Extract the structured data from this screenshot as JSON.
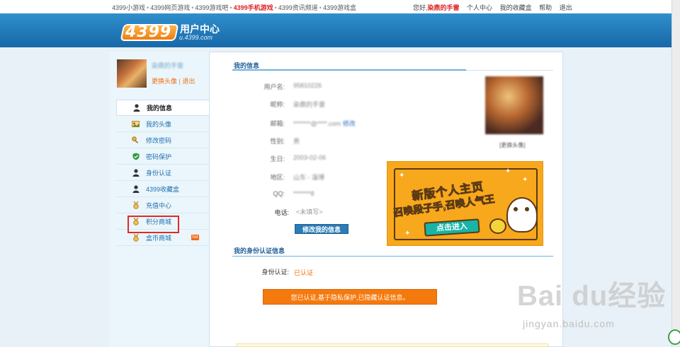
{
  "topbar": {
    "links": [
      "4399小游戏",
      "4399网页游戏",
      "4399游戏吧",
      "4399手机游戏",
      "4399资讯频道",
      "4399游戏盒"
    ],
    "hot_link_index": 3,
    "greeting": "您好,",
    "username": "染鼎的手雷",
    "user_links": [
      "个人中心",
      "我的收藏盒",
      "帮助",
      "退出"
    ]
  },
  "header": {
    "logo": "4399",
    "title": "用户中心",
    "subtitle": "u.4399.com"
  },
  "sidebar": {
    "username": "染鼎的手雷",
    "change_avatar": "更换头像",
    "separator": "|",
    "logout": "退出",
    "items": [
      {
        "label": "我的信息",
        "icon": "person-icon"
      },
      {
        "label": "我的头像",
        "icon": "photo-icon"
      },
      {
        "label": "修改密码",
        "icon": "key-icon"
      },
      {
        "label": "密码保护",
        "icon": "shield-icon"
      },
      {
        "label": "身份认证",
        "icon": "person-icon"
      },
      {
        "label": "4399收藏盒",
        "icon": "person-icon"
      },
      {
        "label": "充值中心",
        "icon": "medal-icon"
      },
      {
        "label": "积分商城",
        "icon": "medal-icon"
      },
      {
        "label": "盒币商城",
        "icon": "medal-icon"
      }
    ],
    "hot_badge": "hot"
  },
  "my_info": {
    "title": "我的信息",
    "rows": [
      {
        "label": "用户名:",
        "value": "95810226"
      },
      {
        "label": "昵称:",
        "value": "染鼎的手雷"
      },
      {
        "label": "邮箱:",
        "value": "*******@****.com",
        "extra": "修改"
      },
      {
        "label": "性别:",
        "value": "男"
      },
      {
        "label": "生日:",
        "value": "2003-02-06"
      },
      {
        "label": "地区:",
        "value": "山东 - 淄博"
      },
      {
        "label": "QQ:",
        "value": "*******8"
      },
      {
        "label": "电话:",
        "value": "<未填写>"
      }
    ],
    "edit_button": "修改我的信息",
    "avatar_caption": "[更换头像]"
  },
  "banner": {
    "line1": "新版个人主页",
    "line2": "召唤段子手,召唤人气王",
    "cta": "点击进入"
  },
  "identity": {
    "title": "我的身份认证信息",
    "label": "身份认证:",
    "status": "已认证",
    "notice": "您已认证,基于隐私保护,已隐藏认证信息。"
  },
  "watermark": {
    "brand": "Bai  du经验",
    "url": "jingyan.baidu.com"
  },
  "colors": {
    "header_blue": "#1f7bbd",
    "link_orange": "#f07010",
    "hot_red": "#e02020",
    "notice_orange": "#f57a0d",
    "highlight_red": "#e02a2a"
  }
}
